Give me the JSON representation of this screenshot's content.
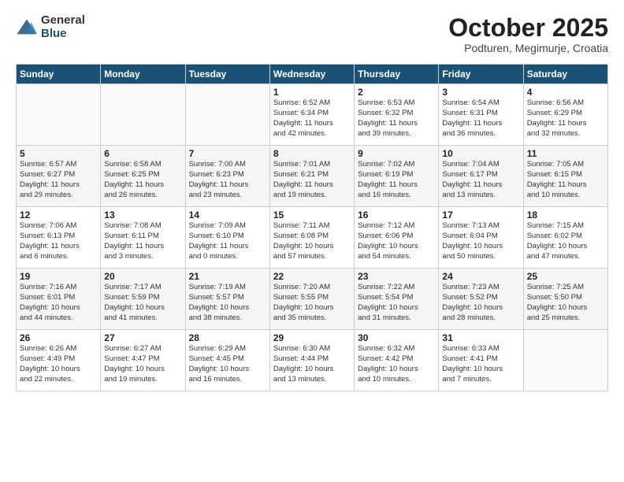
{
  "header": {
    "logo_general": "General",
    "logo_blue": "Blue",
    "month_title": "October 2025",
    "location": "Podturen, Megimurje, Croatia"
  },
  "weekdays": [
    "Sunday",
    "Monday",
    "Tuesday",
    "Wednesday",
    "Thursday",
    "Friday",
    "Saturday"
  ],
  "weeks": [
    [
      {
        "day": "",
        "info": ""
      },
      {
        "day": "",
        "info": ""
      },
      {
        "day": "",
        "info": ""
      },
      {
        "day": "1",
        "info": "Sunrise: 6:52 AM\nSunset: 6:34 PM\nDaylight: 11 hours\nand 42 minutes."
      },
      {
        "day": "2",
        "info": "Sunrise: 6:53 AM\nSunset: 6:32 PM\nDaylight: 11 hours\nand 39 minutes."
      },
      {
        "day": "3",
        "info": "Sunrise: 6:54 AM\nSunset: 6:31 PM\nDaylight: 11 hours\nand 36 minutes."
      },
      {
        "day": "4",
        "info": "Sunrise: 6:56 AM\nSunset: 6:29 PM\nDaylight: 11 hours\nand 32 minutes."
      }
    ],
    [
      {
        "day": "5",
        "info": "Sunrise: 6:57 AM\nSunset: 6:27 PM\nDaylight: 11 hours\nand 29 minutes."
      },
      {
        "day": "6",
        "info": "Sunrise: 6:58 AM\nSunset: 6:25 PM\nDaylight: 11 hours\nand 26 minutes."
      },
      {
        "day": "7",
        "info": "Sunrise: 7:00 AM\nSunset: 6:23 PM\nDaylight: 11 hours\nand 23 minutes."
      },
      {
        "day": "8",
        "info": "Sunrise: 7:01 AM\nSunset: 6:21 PM\nDaylight: 11 hours\nand 19 minutes."
      },
      {
        "day": "9",
        "info": "Sunrise: 7:02 AM\nSunset: 6:19 PM\nDaylight: 11 hours\nand 16 minutes."
      },
      {
        "day": "10",
        "info": "Sunrise: 7:04 AM\nSunset: 6:17 PM\nDaylight: 11 hours\nand 13 minutes."
      },
      {
        "day": "11",
        "info": "Sunrise: 7:05 AM\nSunset: 6:15 PM\nDaylight: 11 hours\nand 10 minutes."
      }
    ],
    [
      {
        "day": "12",
        "info": "Sunrise: 7:06 AM\nSunset: 6:13 PM\nDaylight: 11 hours\nand 6 minutes."
      },
      {
        "day": "13",
        "info": "Sunrise: 7:08 AM\nSunset: 6:11 PM\nDaylight: 11 hours\nand 3 minutes."
      },
      {
        "day": "14",
        "info": "Sunrise: 7:09 AM\nSunset: 6:10 PM\nDaylight: 11 hours\nand 0 minutes."
      },
      {
        "day": "15",
        "info": "Sunrise: 7:11 AM\nSunset: 6:08 PM\nDaylight: 10 hours\nand 57 minutes."
      },
      {
        "day": "16",
        "info": "Sunrise: 7:12 AM\nSunset: 6:06 PM\nDaylight: 10 hours\nand 54 minutes."
      },
      {
        "day": "17",
        "info": "Sunrise: 7:13 AM\nSunset: 6:04 PM\nDaylight: 10 hours\nand 50 minutes."
      },
      {
        "day": "18",
        "info": "Sunrise: 7:15 AM\nSunset: 6:02 PM\nDaylight: 10 hours\nand 47 minutes."
      }
    ],
    [
      {
        "day": "19",
        "info": "Sunrise: 7:16 AM\nSunset: 6:01 PM\nDaylight: 10 hours\nand 44 minutes."
      },
      {
        "day": "20",
        "info": "Sunrise: 7:17 AM\nSunset: 5:59 PM\nDaylight: 10 hours\nand 41 minutes."
      },
      {
        "day": "21",
        "info": "Sunrise: 7:19 AM\nSunset: 5:57 PM\nDaylight: 10 hours\nand 38 minutes."
      },
      {
        "day": "22",
        "info": "Sunrise: 7:20 AM\nSunset: 5:55 PM\nDaylight: 10 hours\nand 35 minutes."
      },
      {
        "day": "23",
        "info": "Sunrise: 7:22 AM\nSunset: 5:54 PM\nDaylight: 10 hours\nand 31 minutes."
      },
      {
        "day": "24",
        "info": "Sunrise: 7:23 AM\nSunset: 5:52 PM\nDaylight: 10 hours\nand 28 minutes."
      },
      {
        "day": "25",
        "info": "Sunrise: 7:25 AM\nSunset: 5:50 PM\nDaylight: 10 hours\nand 25 minutes."
      }
    ],
    [
      {
        "day": "26",
        "info": "Sunrise: 6:26 AM\nSunset: 4:49 PM\nDaylight: 10 hours\nand 22 minutes."
      },
      {
        "day": "27",
        "info": "Sunrise: 6:27 AM\nSunset: 4:47 PM\nDaylight: 10 hours\nand 19 minutes."
      },
      {
        "day": "28",
        "info": "Sunrise: 6:29 AM\nSunset: 4:45 PM\nDaylight: 10 hours\nand 16 minutes."
      },
      {
        "day": "29",
        "info": "Sunrise: 6:30 AM\nSunset: 4:44 PM\nDaylight: 10 hours\nand 13 minutes."
      },
      {
        "day": "30",
        "info": "Sunrise: 6:32 AM\nSunset: 4:42 PM\nDaylight: 10 hours\nand 10 minutes."
      },
      {
        "day": "31",
        "info": "Sunrise: 6:33 AM\nSunset: 4:41 PM\nDaylight: 10 hours\nand 7 minutes."
      },
      {
        "day": "",
        "info": ""
      }
    ]
  ]
}
